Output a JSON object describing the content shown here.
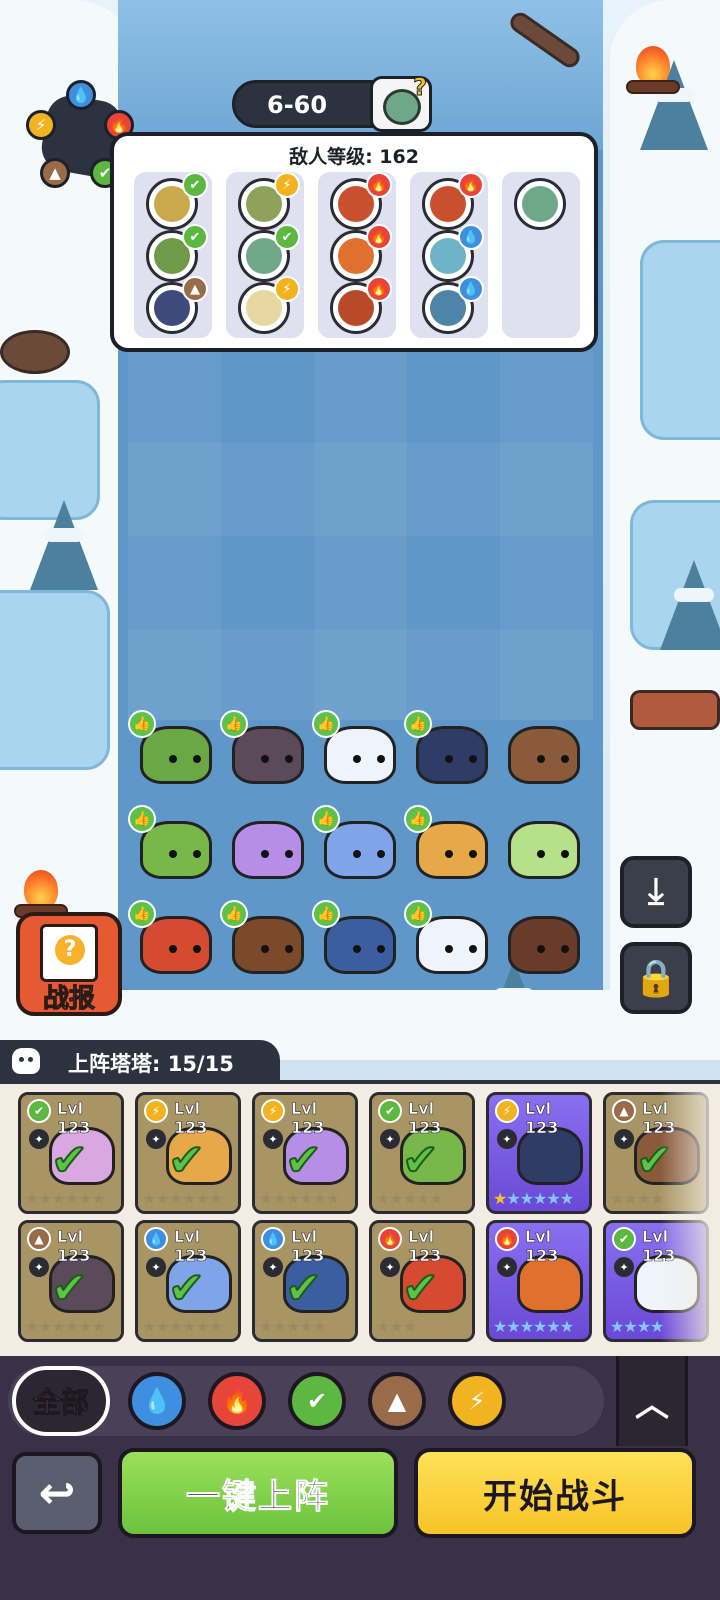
{
  "level": {
    "stage": "6-60"
  },
  "enemy_panel": {
    "title": "敌人等级: 162",
    "columns": [
      [
        {
          "color": "#c9a94c",
          "element": "grass"
        },
        {
          "color": "#6f9a4a",
          "element": "grass"
        },
        {
          "color": "#3e4a7a",
          "element": "earth"
        }
      ],
      [
        {
          "color": "#8fa25a",
          "element": "lightning"
        },
        {
          "color": "#6fa889",
          "element": "grass"
        },
        {
          "color": "#e8d7a0",
          "element": "lightning"
        }
      ],
      [
        {
          "color": "#c9502e",
          "element": "fire"
        },
        {
          "color": "#e0702e",
          "element": "fire"
        },
        {
          "color": "#b84a2a",
          "element": "fire"
        }
      ],
      [
        {
          "color": "#c9502e",
          "element": "fire"
        },
        {
          "color": "#6fb3c9",
          "element": "water"
        },
        {
          "color": "#4d84a8",
          "element": "water"
        }
      ],
      [
        {
          "color": "#6fa889",
          "element": "none"
        }
      ]
    ]
  },
  "element_icons": {
    "water": {
      "color": "#3f8fe0",
      "glyph": "💧"
    },
    "fire": {
      "color": "#e8453a",
      "glyph": "🔥"
    },
    "grass": {
      "color": "#5cb840",
      "glyph": "✔"
    },
    "earth": {
      "color": "#9a6b48",
      "glyph": "▲"
    },
    "lightning": {
      "color": "#f2b321",
      "glyph": "⚡"
    }
  },
  "field_creatures": [
    {
      "color": "#6aa845",
      "buff": true
    },
    {
      "color": "#5b4a5a",
      "buff": true
    },
    {
      "color": "#eef4fb",
      "buff": true
    },
    {
      "color": "#2f3d66",
      "buff": true
    },
    {
      "color": "#8a5a3a",
      "buff": false
    },
    {
      "color": "#78b84a",
      "buff": true
    },
    {
      "color": "#b68ee8",
      "buff": false
    },
    {
      "color": "#7fa4e8",
      "buff": true
    },
    {
      "color": "#e7a84a",
      "buff": true
    },
    {
      "color": "#b7e08a",
      "buff": false
    },
    {
      "color": "#d64a32",
      "buff": true
    },
    {
      "color": "#7a4a2a",
      "buff": true
    },
    {
      "color": "#3a5ea0",
      "buff": true
    },
    {
      "color": "#eef4fb",
      "buff": true
    },
    {
      "color": "#6b3b2a",
      "buff": false
    }
  ],
  "battle_report": {
    "label": "战报"
  },
  "roster": {
    "title": "上阵塔塔: 15/15",
    "level_label": "Lvl 123",
    "row1": [
      {
        "element": "grass",
        "pet": "#d9a8e0",
        "deployed": true,
        "stars": [
          "gold",
          "gold",
          "gold",
          "blue",
          "blue",
          "blue"
        ]
      },
      {
        "element": "lightning",
        "pet": "#e7a84a",
        "deployed": true,
        "stars": [
          "gold",
          "gold",
          "gold",
          "gold",
          "gold",
          "gold"
        ]
      },
      {
        "element": "lightning",
        "pet": "#b68ee8",
        "deployed": true,
        "stars": [
          "gold",
          "gold",
          "gold",
          "gold",
          "gold",
          "gold"
        ]
      },
      {
        "element": "grass",
        "pet": "#78b84a",
        "deployed": true,
        "stars": [
          "gold",
          "gold",
          "gold",
          "gold",
          "gold"
        ]
      },
      {
        "element": "lightning",
        "pet": "#2f3d66",
        "deployed": false,
        "stars": [
          "gold",
          "blue",
          "blue",
          "blue",
          "blue",
          "blue"
        ]
      },
      {
        "element": "earth",
        "pet": "#8a5a3a",
        "deployed": true,
        "stars": [
          "gold",
          "gold",
          "gold",
          "gold"
        ]
      }
    ],
    "row2": [
      {
        "element": "earth",
        "pet": "#5b4a5a",
        "deployed": true,
        "stars": [
          "gold",
          "gold",
          "gold",
          "gold",
          "gold",
          "gold"
        ]
      },
      {
        "element": "water",
        "pet": "#7fa4e8",
        "deployed": true,
        "stars": [
          "gold",
          "gold",
          "gold",
          "gold",
          "gold",
          "gold"
        ]
      },
      {
        "element": "water",
        "pet": "#3a5ea0",
        "deployed": true,
        "stars": [
          "gold",
          "gold",
          "gold",
          "gold",
          "gold"
        ]
      },
      {
        "element": "fire",
        "pet": "#d64a32",
        "deployed": true,
        "stars": [
          "gold",
          "gold",
          "gold"
        ]
      },
      {
        "element": "fire",
        "pet": "#e0702e",
        "deployed": false,
        "stars": [
          "blue",
          "blue",
          "blue",
          "blue",
          "blue",
          "blue"
        ]
      },
      {
        "element": "grass",
        "pet": "#eef4fb",
        "deployed": false,
        "stars": [
          "blue",
          "blue",
          "blue",
          "blue"
        ]
      }
    ]
  },
  "filters": {
    "all_label": "全部",
    "chips": [
      "water",
      "fire",
      "grass",
      "earth",
      "lightning"
    ]
  },
  "actions": {
    "auto_deploy": "一键上阵",
    "start_battle": "开始战斗"
  }
}
